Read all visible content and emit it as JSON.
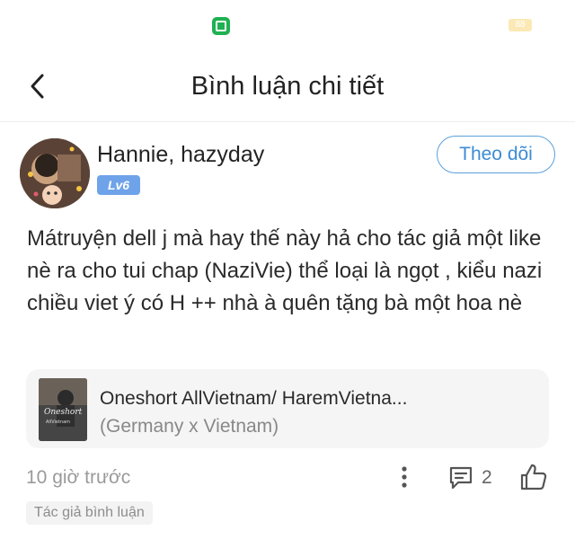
{
  "status_bar": {
    "app_icon": "shop-app-icon",
    "badge_text": "88",
    "badge_color": "#fbe9b5",
    "app_icon_color": "#1fb152"
  },
  "header": {
    "title": "Bình luận chi tiết",
    "back_icon": "chevron-left-icon"
  },
  "comment": {
    "username": "Hannie, hazyday",
    "level": "Lv6",
    "level_color": "#6fa3e9",
    "follow_label": "Theo dõi",
    "follow_color": "#3d8bd3",
    "body": "Mátruyện dell j mà hay thế này hả cho tác giả một like nè ra cho tui chap (NaziVie) thể loại là ngọt , kiểu nazi chiều viet ý có H ++ nhà à quên tặng bà một hoa nè",
    "story": {
      "title": "Oneshort AllVietnam/ HaremVietna...",
      "subtitle": "(Germany x Vietnam)",
      "cover_text": "Oneshort",
      "cover_subtext": "AllVietnam"
    },
    "timestamp": "10 giờ trước",
    "reply_count": "2",
    "author_tag": "Tác giả bình luận"
  },
  "icons": {
    "more": "more-vertical-icon",
    "reply": "comment-icon",
    "like": "thumbs-up-icon"
  }
}
